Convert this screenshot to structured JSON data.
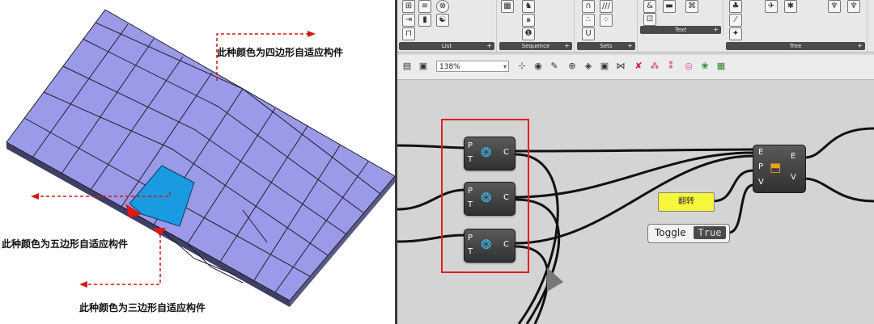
{
  "annotations": {
    "quad": "此种颜色为四边形自适应构件",
    "penta": "此种颜色为五边形自适应构件",
    "tri": "此种颜色为三边形自适应构件"
  },
  "ribbon": {
    "groups": [
      "List",
      "Sequence",
      "Sets",
      "Text",
      "Tree"
    ]
  },
  "toolbar": {
    "zoom": "138%"
  },
  "components": {
    "inputs": [
      "P",
      "T"
    ],
    "output": "C"
  },
  "bigcomp": {
    "inputs": [
      "E",
      "P",
      "V"
    ],
    "outputs": [
      "E",
      "V"
    ]
  },
  "panel": {
    "text": "翻转"
  },
  "toggle": {
    "label": "Toggle",
    "value": "True"
  },
  "colors": {
    "panel_fill": "#9a9ae8",
    "penta": "#1a9ae0",
    "tri": "#e01818",
    "arrow": "#d01818"
  }
}
